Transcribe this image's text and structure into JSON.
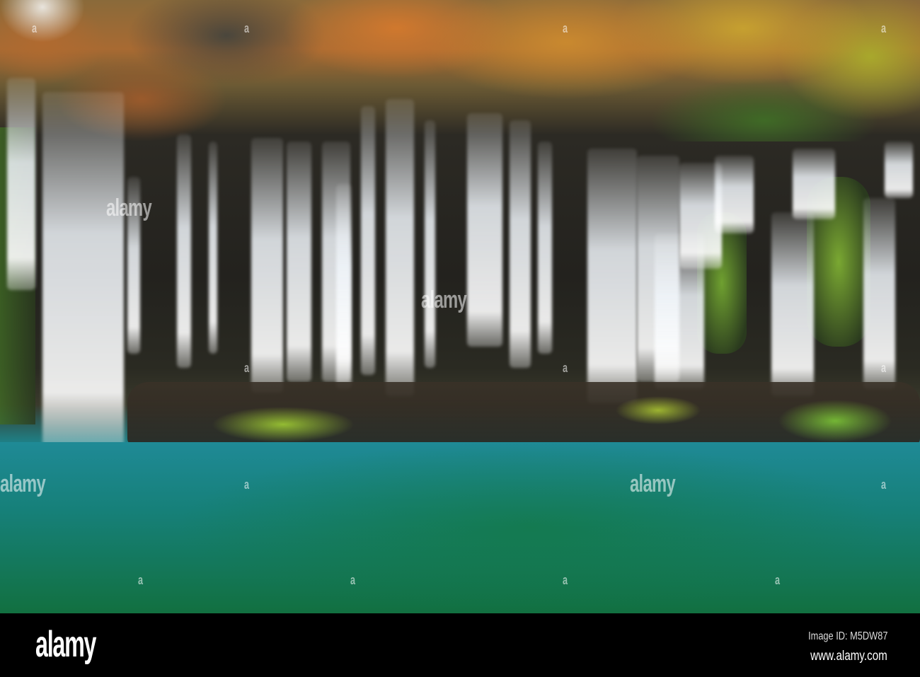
{
  "image": {
    "subject": "waterfall",
    "watermark": "alamy"
  },
  "footer": {
    "logo": "alamy",
    "image_id": "Image ID: M5DW87",
    "url": "www.alamy.com"
  },
  "colors": {
    "pool": "#168079",
    "rock": "#23221e",
    "foliage": "#c9892f"
  }
}
